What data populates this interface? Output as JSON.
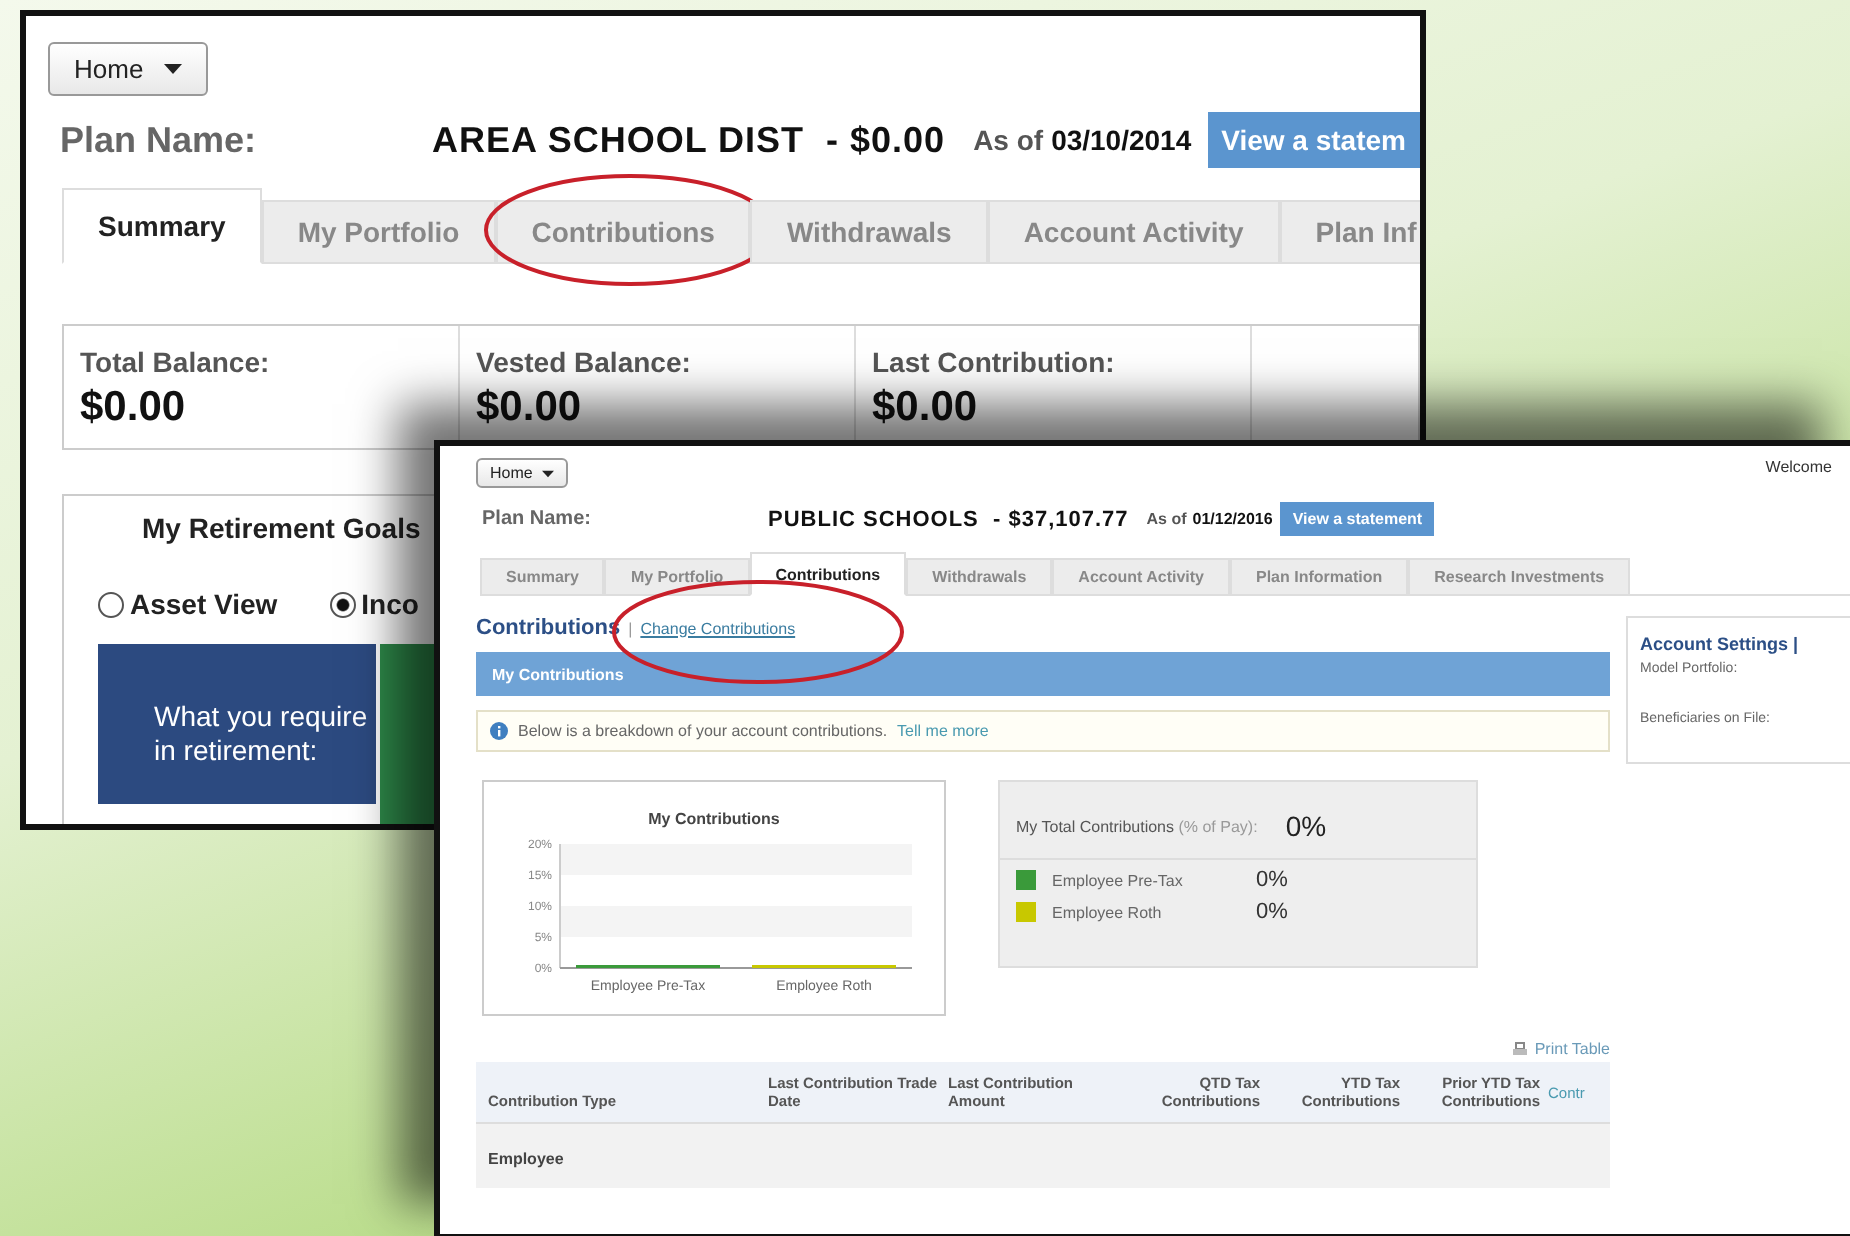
{
  "back_window": {
    "home_button": "Home",
    "plan_label": "Plan Name:",
    "plan_name": "AREA SCHOOL DIST  - $0.00",
    "as_of_label": "As of",
    "as_of_date": "03/10/2014",
    "statement_button": "View a statem",
    "tabs": [
      {
        "label": "Summary",
        "selected": true
      },
      {
        "label": "My Portfolio",
        "selected": false
      },
      {
        "label": "Contributions",
        "selected": false,
        "circled": true
      },
      {
        "label": "Withdrawals",
        "selected": false
      },
      {
        "label": "Account Activity",
        "selected": false
      },
      {
        "label": "Plan Inf",
        "selected": false
      }
    ],
    "balances": [
      {
        "label": "Total Balance:",
        "value": "$0.00"
      },
      {
        "label": "Vested Balance:",
        "value": "$0.00"
      },
      {
        "label": "Last Contribution:",
        "value": "$0.00"
      }
    ],
    "goals": {
      "title": "My Retirement Goals",
      "views": [
        {
          "label": "Asset View",
          "selected": false
        },
        {
          "label": "Inco",
          "selected": true
        }
      ],
      "tile_text": "What you require in retirement:"
    }
  },
  "front_window": {
    "home_button": "Home",
    "welcome": "Welcome",
    "plan_label": "Plan Name:",
    "plan_name": "PUBLIC SCHOOLS  - $37,107.77",
    "as_of_label": "As of",
    "as_of_date": "01/12/2016",
    "statement_button": "View a statement",
    "tabs": [
      {
        "label": "Summary",
        "selected": false
      },
      {
        "label": "My Portfolio",
        "selected": false
      },
      {
        "label": "Contributions",
        "selected": true
      },
      {
        "label": "Withdrawals",
        "selected": false
      },
      {
        "label": "Account Activity",
        "selected": false
      },
      {
        "label": "Plan Information",
        "selected": false
      },
      {
        "label": "Research Investments",
        "selected": false
      }
    ],
    "section_title": "Contributions",
    "separator": "|",
    "change_link": {
      "label": "Change Contributions",
      "circled": true
    },
    "bar_title": "My Contributions",
    "info_text": "Below is a breakdown of your account contributions.",
    "info_link": "Tell me more",
    "account_settings": {
      "title": "Account Settings |",
      "items": [
        "Model Portfolio:",
        "Beneficiaries on File:"
      ]
    },
    "chart": {
      "chart_data": {
        "type": "bar",
        "title": "My Contributions",
        "categories": [
          "Employee Pre-Tax",
          "Employee Roth"
        ],
        "series": [
          {
            "values": [
              0,
              0
            ]
          }
        ],
        "ylim": [
          0,
          20
        ],
        "yticks": [
          {
            "value": 0,
            "label": "0%"
          },
          {
            "value": 5,
            "label": "5%"
          },
          {
            "value": 10,
            "label": "10%"
          },
          {
            "value": 15,
            "label": "15%"
          },
          {
            "value": 20,
            "label": "20%"
          }
        ]
      }
    },
    "totals": {
      "label": "My Total Contributions",
      "note": "(% of Pay):",
      "value": "0%",
      "items": [
        {
          "name": "Employee Pre-Tax",
          "value": "0%",
          "color": "#3a9a3a"
        },
        {
          "name": "Employee Roth",
          "value": "0%",
          "color": "#c8c800"
        }
      ]
    },
    "print_link": "Print Table",
    "table": {
      "columns": [
        "Contribution Type",
        "Last Contribution Trade Date",
        "Last Contribution Amount",
        "QTD Tax Contributions",
        "YTD Tax Contributions",
        "Prior YTD Tax Contributions",
        "Contr"
      ],
      "group": "Employee"
    }
  }
}
